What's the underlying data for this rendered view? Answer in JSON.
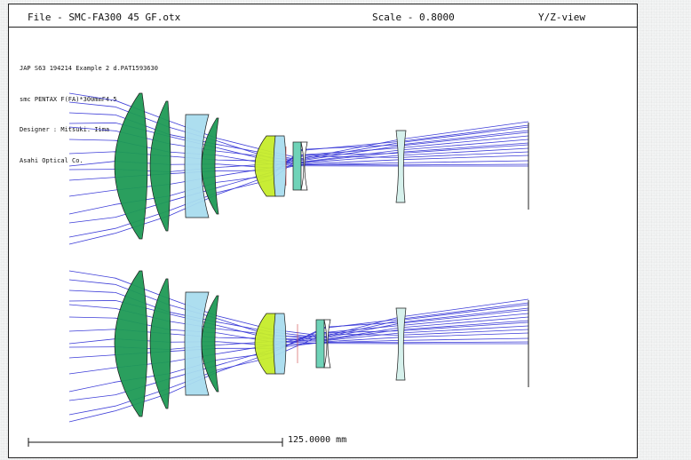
{
  "header": {
    "file_label": "File - SMC-FA300 45 GF.otx",
    "scale_label": "Scale - 0.8000",
    "view_label": "Y/Z-view"
  },
  "info_lines": [
    "JAP S63 194214 Example 2 d.PAT1593630",
    "smc PENTAX F(FA)*300mmF4.5",
    "Designer : Mitsuki. Iima",
    "Asahi Optical Co."
  ],
  "scale_bar": {
    "label": "125.0000 mm"
  },
  "colors": {
    "ray": "#3d3dd8",
    "lens_dark_green": "#1f9a55",
    "lens_light_blue": "#a9dcee",
    "lens_yellow_green": "#c6ec2a",
    "lens_teal": "#6fd3b8",
    "lens_pale_teal": "#d6f1ec",
    "lens_outline": "#1c1c1c"
  }
}
